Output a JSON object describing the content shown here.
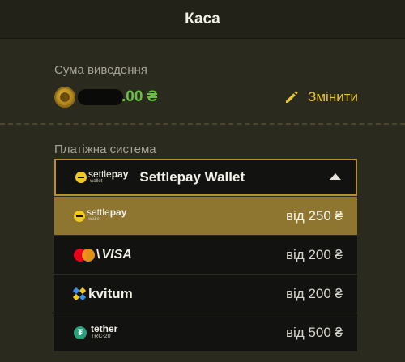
{
  "header": {
    "title": "Каса"
  },
  "amount": {
    "label": "Сума виведення",
    "value_suffix": ".00 ₴",
    "change_label": "Змінити"
  },
  "payment": {
    "label": "Платіжна система",
    "selected": {
      "logo_main": "settle",
      "logo_bold": "pay",
      "logo_sub": "wallet",
      "name": "Settlepay Wallet"
    },
    "options": [
      {
        "logo": "settlepay",
        "logo_main": "settle",
        "logo_bold": "pay",
        "logo_sub": "wallet",
        "price": "від 250 ₴"
      },
      {
        "logo": "mastercard-visa",
        "slash": "\\",
        "text": "VISA",
        "price": "від 200 ₴"
      },
      {
        "logo": "kvitum",
        "text": "kvitum",
        "price": "від 200 ₴"
      },
      {
        "logo": "tether",
        "symbol": "₮",
        "text": "tether",
        "sub": "TRC-20",
        "price": "від 500 ₴"
      }
    ]
  },
  "colors": {
    "accent": "#e8c330",
    "active_option": "#8e7630",
    "amount_green": "#68c040",
    "border_gold": "#b6902e"
  },
  "icons": {
    "coin": "coin-icon",
    "edit": "pencil-icon",
    "dropdown": "triangle-up-icon"
  }
}
